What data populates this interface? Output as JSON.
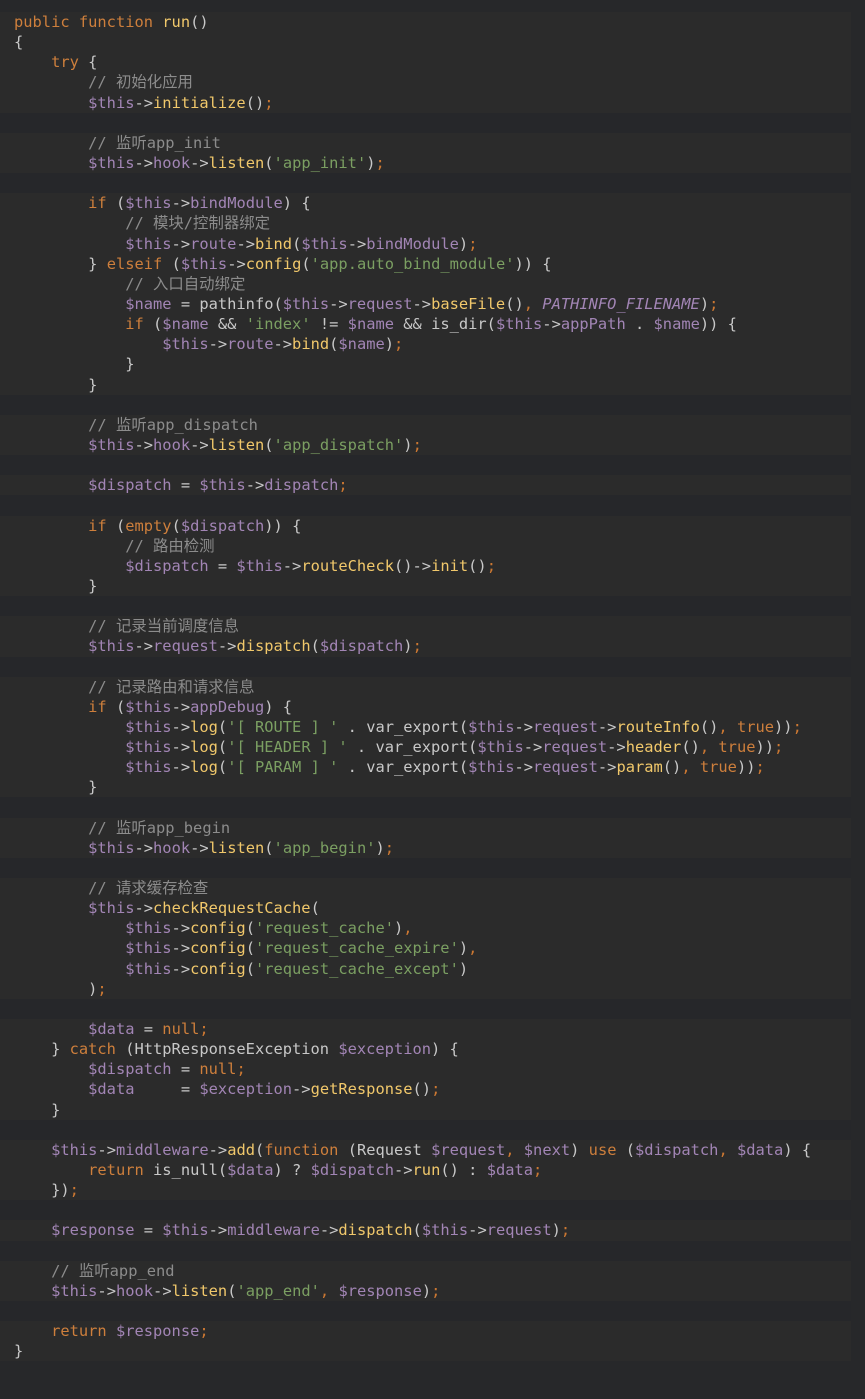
{
  "colors": {
    "background": "#27282a",
    "code_background": "#2b2b2b",
    "keyword": "#ce7f3c",
    "function": "#f1c86b",
    "variable": "#a285b5",
    "string": "#7b9f62",
    "comment": "#8c8c8c",
    "plain": "#c8c8c8"
  },
  "lines": [
    [
      [
        "kw",
        "public "
      ],
      [
        "kw",
        "function "
      ],
      [
        "fn",
        "run"
      ],
      [
        "plain",
        "()"
      ]
    ],
    [
      [
        "plain",
        "{"
      ]
    ],
    [
      [
        "plain",
        "    "
      ],
      [
        "kw",
        "try "
      ],
      [
        "plain",
        "{"
      ]
    ],
    [
      [
        "plain",
        "        "
      ],
      [
        "com",
        "// 初始化应用"
      ]
    ],
    [
      [
        "plain",
        "        "
      ],
      [
        "var",
        "$this"
      ],
      [
        "plain",
        "->"
      ],
      [
        "fn",
        "initialize"
      ],
      [
        "plain",
        "()"
      ],
      [
        "semi",
        ";"
      ]
    ],
    [],
    [
      [
        "plain",
        "        "
      ],
      [
        "com",
        "// 监听app_init"
      ]
    ],
    [
      [
        "plain",
        "        "
      ],
      [
        "var",
        "$this"
      ],
      [
        "plain",
        "->"
      ],
      [
        "var",
        "hook"
      ],
      [
        "plain",
        "->"
      ],
      [
        "fn",
        "listen"
      ],
      [
        "plain",
        "("
      ],
      [
        "str",
        "'app_init'"
      ],
      [
        "plain",
        ")"
      ],
      [
        "semi",
        ";"
      ]
    ],
    [],
    [
      [
        "plain",
        "        "
      ],
      [
        "kw",
        "if "
      ],
      [
        "plain",
        "("
      ],
      [
        "var",
        "$this"
      ],
      [
        "plain",
        "->"
      ],
      [
        "var",
        "bindModule"
      ],
      [
        "plain",
        ") {"
      ]
    ],
    [
      [
        "plain",
        "            "
      ],
      [
        "com",
        "// 模块/控制器绑定"
      ]
    ],
    [
      [
        "plain",
        "            "
      ],
      [
        "var",
        "$this"
      ],
      [
        "plain",
        "->"
      ],
      [
        "var",
        "route"
      ],
      [
        "plain",
        "->"
      ],
      [
        "fn",
        "bind"
      ],
      [
        "plain",
        "("
      ],
      [
        "var",
        "$this"
      ],
      [
        "plain",
        "->"
      ],
      [
        "var",
        "bindModule"
      ],
      [
        "plain",
        ")"
      ],
      [
        "semi",
        ";"
      ]
    ],
    [
      [
        "plain",
        "        "
      ],
      [
        "plain",
        "} "
      ],
      [
        "kw",
        "elseif "
      ],
      [
        "plain",
        "("
      ],
      [
        "var",
        "$this"
      ],
      [
        "plain",
        "->"
      ],
      [
        "fn",
        "config"
      ],
      [
        "plain",
        "("
      ],
      [
        "str",
        "'app.auto_bind_module'"
      ],
      [
        "plain",
        ")) {"
      ]
    ],
    [
      [
        "plain",
        "            "
      ],
      [
        "com",
        "// 入口自动绑定"
      ]
    ],
    [
      [
        "plain",
        "            "
      ],
      [
        "var",
        "$name"
      ],
      [
        "plain",
        " = pathinfo("
      ],
      [
        "var",
        "$this"
      ],
      [
        "plain",
        "->"
      ],
      [
        "var",
        "request"
      ],
      [
        "plain",
        "->"
      ],
      [
        "fn",
        "baseFile"
      ],
      [
        "plain",
        "()"
      ],
      [
        "semi",
        ", "
      ],
      [
        "const",
        "PATHINFO_FILENAME"
      ],
      [
        "plain",
        ")"
      ],
      [
        "semi",
        ";"
      ]
    ],
    [
      [
        "plain",
        "            "
      ],
      [
        "kw",
        "if "
      ],
      [
        "plain",
        "("
      ],
      [
        "var",
        "$name"
      ],
      [
        "plain",
        " && "
      ],
      [
        "str",
        "'index'"
      ],
      [
        "plain",
        " != "
      ],
      [
        "var",
        "$name"
      ],
      [
        "plain",
        " && is_dir("
      ],
      [
        "var",
        "$this"
      ],
      [
        "plain",
        "->"
      ],
      [
        "var",
        "appPath"
      ],
      [
        "plain",
        " . "
      ],
      [
        "var",
        "$name"
      ],
      [
        "plain",
        ")) {"
      ]
    ],
    [
      [
        "plain",
        "                "
      ],
      [
        "var",
        "$this"
      ],
      [
        "plain",
        "->"
      ],
      [
        "var",
        "route"
      ],
      [
        "plain",
        "->"
      ],
      [
        "fn",
        "bind"
      ],
      [
        "plain",
        "("
      ],
      [
        "var",
        "$name"
      ],
      [
        "plain",
        ")"
      ],
      [
        "semi",
        ";"
      ]
    ],
    [
      [
        "plain",
        "            }"
      ]
    ],
    [
      [
        "plain",
        "        }"
      ]
    ],
    [],
    [
      [
        "plain",
        "        "
      ],
      [
        "com",
        "// 监听app_dispatch"
      ]
    ],
    [
      [
        "plain",
        "        "
      ],
      [
        "var",
        "$this"
      ],
      [
        "plain",
        "->"
      ],
      [
        "var",
        "hook"
      ],
      [
        "plain",
        "->"
      ],
      [
        "fn",
        "listen"
      ],
      [
        "plain",
        "("
      ],
      [
        "str",
        "'app_dispatch'"
      ],
      [
        "plain",
        ")"
      ],
      [
        "semi",
        ";"
      ]
    ],
    [],
    [
      [
        "plain",
        "        "
      ],
      [
        "var",
        "$dispatch"
      ],
      [
        "plain",
        " = "
      ],
      [
        "var",
        "$this"
      ],
      [
        "plain",
        "->"
      ],
      [
        "var",
        "dispatch"
      ],
      [
        "semi",
        ";"
      ]
    ],
    [],
    [
      [
        "plain",
        "        "
      ],
      [
        "kw",
        "if "
      ],
      [
        "plain",
        "("
      ],
      [
        "kw",
        "empty"
      ],
      [
        "plain",
        "("
      ],
      [
        "var",
        "$dispatch"
      ],
      [
        "plain",
        ")) {"
      ]
    ],
    [
      [
        "plain",
        "            "
      ],
      [
        "com",
        "// 路由检测"
      ]
    ],
    [
      [
        "plain",
        "            "
      ],
      [
        "var",
        "$dispatch"
      ],
      [
        "plain",
        " = "
      ],
      [
        "var",
        "$this"
      ],
      [
        "plain",
        "->"
      ],
      [
        "fn",
        "routeCheck"
      ],
      [
        "plain",
        "()->"
      ],
      [
        "fn",
        "init"
      ],
      [
        "plain",
        "()"
      ],
      [
        "semi",
        ";"
      ]
    ],
    [
      [
        "plain",
        "        }"
      ]
    ],
    [],
    [
      [
        "plain",
        "        "
      ],
      [
        "com",
        "// 记录当前调度信息"
      ]
    ],
    [
      [
        "plain",
        "        "
      ],
      [
        "var",
        "$this"
      ],
      [
        "plain",
        "->"
      ],
      [
        "var",
        "request"
      ],
      [
        "plain",
        "->"
      ],
      [
        "fn",
        "dispatch"
      ],
      [
        "plain",
        "("
      ],
      [
        "var",
        "$dispatch"
      ],
      [
        "plain",
        ")"
      ],
      [
        "semi",
        ";"
      ]
    ],
    [],
    [
      [
        "plain",
        "        "
      ],
      [
        "com",
        "// 记录路由和请求信息"
      ]
    ],
    [
      [
        "plain",
        "        "
      ],
      [
        "kw",
        "if "
      ],
      [
        "plain",
        "("
      ],
      [
        "var",
        "$this"
      ],
      [
        "plain",
        "->"
      ],
      [
        "var",
        "appDebug"
      ],
      [
        "plain",
        ") {"
      ]
    ],
    [
      [
        "plain",
        "            "
      ],
      [
        "var",
        "$this"
      ],
      [
        "plain",
        "->"
      ],
      [
        "fn",
        "log"
      ],
      [
        "plain",
        "("
      ],
      [
        "str",
        "'[ ROUTE ] '"
      ],
      [
        "plain",
        " . var_export("
      ],
      [
        "var",
        "$this"
      ],
      [
        "plain",
        "->"
      ],
      [
        "var",
        "request"
      ],
      [
        "plain",
        "->"
      ],
      [
        "fn",
        "routeInfo"
      ],
      [
        "plain",
        "()"
      ],
      [
        "semi",
        ", "
      ],
      [
        "kw",
        "true"
      ],
      [
        "plain",
        "))"
      ],
      [
        "semi",
        ";"
      ]
    ],
    [
      [
        "plain",
        "            "
      ],
      [
        "var",
        "$this"
      ],
      [
        "plain",
        "->"
      ],
      [
        "fn",
        "log"
      ],
      [
        "plain",
        "("
      ],
      [
        "str",
        "'[ HEADER ] '"
      ],
      [
        "plain",
        " . var_export("
      ],
      [
        "var",
        "$this"
      ],
      [
        "plain",
        "->"
      ],
      [
        "var",
        "request"
      ],
      [
        "plain",
        "->"
      ],
      [
        "fn",
        "header"
      ],
      [
        "plain",
        "()"
      ],
      [
        "semi",
        ", "
      ],
      [
        "kw",
        "true"
      ],
      [
        "plain",
        "))"
      ],
      [
        "semi",
        ";"
      ]
    ],
    [
      [
        "plain",
        "            "
      ],
      [
        "var",
        "$this"
      ],
      [
        "plain",
        "->"
      ],
      [
        "fn",
        "log"
      ],
      [
        "plain",
        "("
      ],
      [
        "str",
        "'[ PARAM ] '"
      ],
      [
        "plain",
        " . var_export("
      ],
      [
        "var",
        "$this"
      ],
      [
        "plain",
        "->"
      ],
      [
        "var",
        "request"
      ],
      [
        "plain",
        "->"
      ],
      [
        "fn",
        "param"
      ],
      [
        "plain",
        "()"
      ],
      [
        "semi",
        ", "
      ],
      [
        "kw",
        "true"
      ],
      [
        "plain",
        "))"
      ],
      [
        "semi",
        ";"
      ]
    ],
    [
      [
        "plain",
        "        }"
      ]
    ],
    [],
    [
      [
        "plain",
        "        "
      ],
      [
        "com",
        "// 监听app_begin"
      ]
    ],
    [
      [
        "plain",
        "        "
      ],
      [
        "var",
        "$this"
      ],
      [
        "plain",
        "->"
      ],
      [
        "var",
        "hook"
      ],
      [
        "plain",
        "->"
      ],
      [
        "fn",
        "listen"
      ],
      [
        "plain",
        "("
      ],
      [
        "str",
        "'app_begin'"
      ],
      [
        "plain",
        ")"
      ],
      [
        "semi",
        ";"
      ]
    ],
    [],
    [
      [
        "plain",
        "        "
      ],
      [
        "com",
        "// 请求缓存检查"
      ]
    ],
    [
      [
        "plain",
        "        "
      ],
      [
        "var",
        "$this"
      ],
      [
        "plain",
        "->"
      ],
      [
        "fn",
        "checkRequestCache"
      ],
      [
        "plain",
        "("
      ]
    ],
    [
      [
        "plain",
        "            "
      ],
      [
        "var",
        "$this"
      ],
      [
        "plain",
        "->"
      ],
      [
        "fn",
        "config"
      ],
      [
        "plain",
        "("
      ],
      [
        "str",
        "'request_cache'"
      ],
      [
        "plain",
        ")"
      ],
      [
        "semi",
        ","
      ]
    ],
    [
      [
        "plain",
        "            "
      ],
      [
        "var",
        "$this"
      ],
      [
        "plain",
        "->"
      ],
      [
        "fn",
        "config"
      ],
      [
        "plain",
        "("
      ],
      [
        "str",
        "'request_cache_expire'"
      ],
      [
        "plain",
        ")"
      ],
      [
        "semi",
        ","
      ]
    ],
    [
      [
        "plain",
        "            "
      ],
      [
        "var",
        "$this"
      ],
      [
        "plain",
        "->"
      ],
      [
        "fn",
        "config"
      ],
      [
        "plain",
        "("
      ],
      [
        "str",
        "'request_cache_except'"
      ],
      [
        "plain",
        ")"
      ]
    ],
    [
      [
        "plain",
        "        )"
      ],
      [
        "semi",
        ";"
      ]
    ],
    [],
    [
      [
        "plain",
        "        "
      ],
      [
        "var",
        "$data"
      ],
      [
        "plain",
        " = "
      ],
      [
        "kw",
        "null"
      ],
      [
        "semi",
        ";"
      ]
    ],
    [
      [
        "plain",
        "    } "
      ],
      [
        "kw",
        "catch "
      ],
      [
        "plain",
        "(HttpResponseException "
      ],
      [
        "var",
        "$exception"
      ],
      [
        "plain",
        ") {"
      ]
    ],
    [
      [
        "plain",
        "        "
      ],
      [
        "var",
        "$dispatch"
      ],
      [
        "plain",
        " = "
      ],
      [
        "kw",
        "null"
      ],
      [
        "semi",
        ";"
      ]
    ],
    [
      [
        "plain",
        "        "
      ],
      [
        "var",
        "$data"
      ],
      [
        "plain",
        "     = "
      ],
      [
        "var",
        "$exception"
      ],
      [
        "plain",
        "->"
      ],
      [
        "fn",
        "getResponse"
      ],
      [
        "plain",
        "()"
      ],
      [
        "semi",
        ";"
      ]
    ],
    [
      [
        "plain",
        "    }"
      ]
    ],
    [],
    [
      [
        "plain",
        "    "
      ],
      [
        "var",
        "$this"
      ],
      [
        "plain",
        "->"
      ],
      [
        "var",
        "middleware"
      ],
      [
        "plain",
        "->"
      ],
      [
        "fn",
        "add"
      ],
      [
        "plain",
        "("
      ],
      [
        "kw",
        "function "
      ],
      [
        "plain",
        "(Request "
      ],
      [
        "var",
        "$request"
      ],
      [
        "semi",
        ", "
      ],
      [
        "var",
        "$next"
      ],
      [
        "plain",
        ") "
      ],
      [
        "kw",
        "use "
      ],
      [
        "plain",
        "("
      ],
      [
        "var",
        "$dispatch"
      ],
      [
        "semi",
        ", "
      ],
      [
        "var",
        "$data"
      ],
      [
        "plain",
        ") {"
      ]
    ],
    [
      [
        "plain",
        "        "
      ],
      [
        "kw",
        "return "
      ],
      [
        "plain",
        "is_null("
      ],
      [
        "var",
        "$data"
      ],
      [
        "plain",
        ") ? "
      ],
      [
        "var",
        "$dispatch"
      ],
      [
        "plain",
        "->"
      ],
      [
        "fn",
        "run"
      ],
      [
        "plain",
        "() : "
      ],
      [
        "var",
        "$data"
      ],
      [
        "semi",
        ";"
      ]
    ],
    [
      [
        "plain",
        "    })"
      ],
      [
        "semi",
        ";"
      ]
    ],
    [],
    [
      [
        "plain",
        "    "
      ],
      [
        "var",
        "$response"
      ],
      [
        "plain",
        " = "
      ],
      [
        "var",
        "$this"
      ],
      [
        "plain",
        "->"
      ],
      [
        "var",
        "middleware"
      ],
      [
        "plain",
        "->"
      ],
      [
        "fn",
        "dispatch"
      ],
      [
        "plain",
        "("
      ],
      [
        "var",
        "$this"
      ],
      [
        "plain",
        "->"
      ],
      [
        "var",
        "request"
      ],
      [
        "plain",
        ")"
      ],
      [
        "semi",
        ";"
      ]
    ],
    [],
    [
      [
        "plain",
        "    "
      ],
      [
        "com",
        "// 监听app_end"
      ]
    ],
    [
      [
        "plain",
        "    "
      ],
      [
        "var",
        "$this"
      ],
      [
        "plain",
        "->"
      ],
      [
        "var",
        "hook"
      ],
      [
        "plain",
        "->"
      ],
      [
        "fn",
        "listen"
      ],
      [
        "plain",
        "("
      ],
      [
        "str",
        "'app_end'"
      ],
      [
        "semi",
        ", "
      ],
      [
        "var",
        "$response"
      ],
      [
        "plain",
        ")"
      ],
      [
        "semi",
        ";"
      ]
    ],
    [],
    [
      [
        "plain",
        "    "
      ],
      [
        "kw",
        "return "
      ],
      [
        "var",
        "$response"
      ],
      [
        "semi",
        ";"
      ]
    ],
    [
      [
        "plain",
        "}"
      ]
    ]
  ]
}
